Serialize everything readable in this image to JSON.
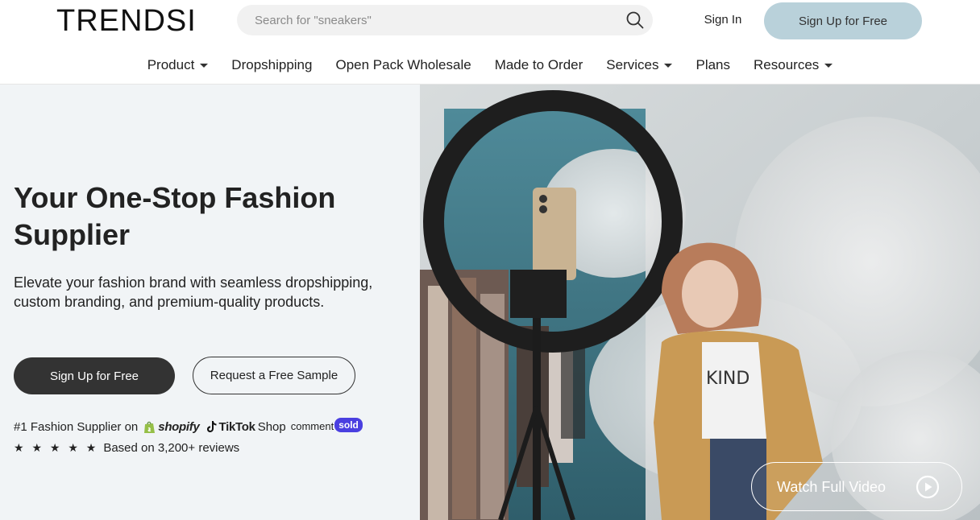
{
  "header": {
    "logo": "TRENDSI",
    "search_placeholder": "Search for \"sneakers\"",
    "sign_in": "Sign In",
    "sign_up": "Sign Up for Free"
  },
  "nav": [
    {
      "label": "Product",
      "dropdown": true
    },
    {
      "label": "Dropshipping",
      "dropdown": false
    },
    {
      "label": "Open Pack Wholesale",
      "dropdown": false
    },
    {
      "label": "Made to Order",
      "dropdown": false
    },
    {
      "label": "Services",
      "dropdown": true
    },
    {
      "label": "Plans",
      "dropdown": false
    },
    {
      "label": "Resources",
      "dropdown": true
    }
  ],
  "hero": {
    "title": "Your One-Stop Fashion Supplier",
    "subtitle": "Elevate your fashion brand with seamless dropshipping, custom branding, and premium-quality products.",
    "primary_cta": "Sign Up for Free",
    "secondary_cta": "Request a Free Sample",
    "supplier_prefix": "#1 Fashion Supplier on",
    "partners": {
      "shopify": "shopify",
      "tiktok": "TikTok",
      "tiktok_shop": "Shop",
      "comment": "comment",
      "sold": "sold"
    },
    "rating_stars": 5,
    "stars_text": "★ ★ ★ ★ ★",
    "reviews": "Based on 3,200+ reviews",
    "video_cta": "Watch Full Video",
    "image_shirt_text": "KIND"
  },
  "colors": {
    "signup_top_bg": "#b9d1da",
    "primary_btn_bg": "#333333",
    "hero_left_bg": "#f1f4f6",
    "sold_badge": "#4a3fe0"
  }
}
